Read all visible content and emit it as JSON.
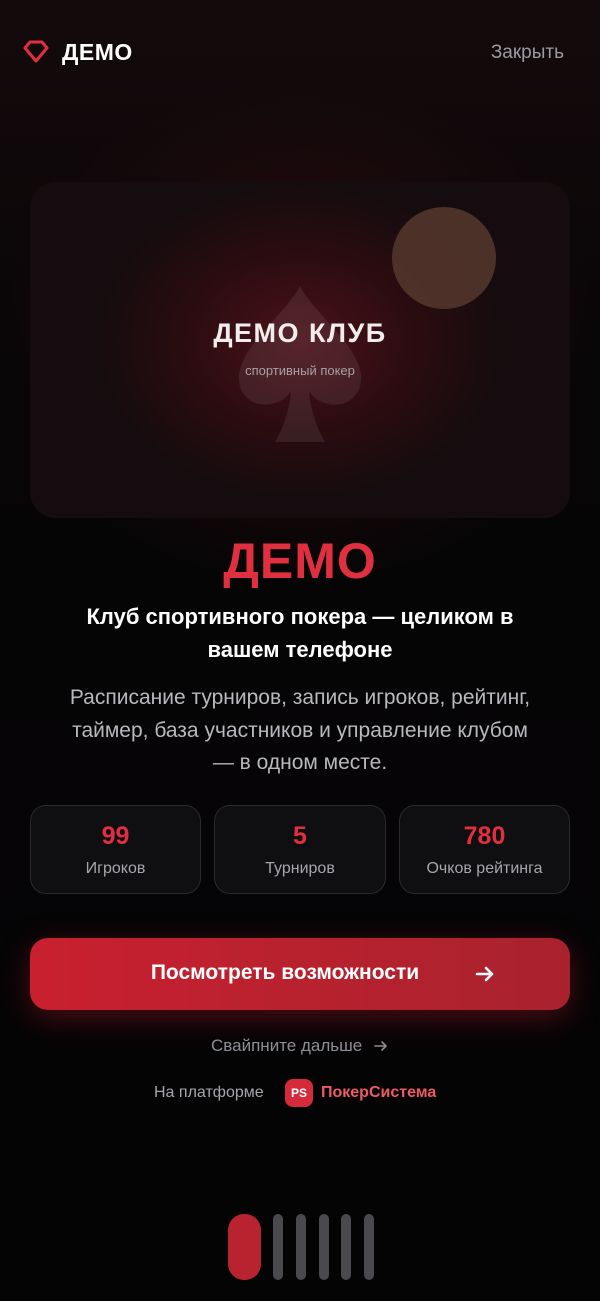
{
  "header": {
    "brand": "ДЕМО",
    "close_label": "Закрыть",
    "logo_icon": "diamond-icon",
    "accent_color": "#e0303f"
  },
  "hero": {
    "title": "ДЕМО КЛУБ",
    "subtitle": "спортивный покер",
    "icon": "spade-icon"
  },
  "main": {
    "brand": "ДЕМО",
    "tagline": "Клуб спортивного покера — целиком в вашем телефоне",
    "description": "Расписание турниров, запись игроков, рейтинг, таймер, база участников и управление клубом — в одном месте."
  },
  "stats": [
    {
      "value": "99",
      "label": "Игроков"
    },
    {
      "value": "5",
      "label": "Турниров"
    },
    {
      "value": "780",
      "label": "Очков рейтинга"
    }
  ],
  "cta": {
    "label": "Посмотреть возможности",
    "icon": "arrow-right-icon"
  },
  "swipe_hint": "Свайпните дальше",
  "platform": {
    "label": "На платформе",
    "badge": "PS",
    "name": "ПокерСистема"
  },
  "pager": {
    "total": 6,
    "active_index": 0
  }
}
